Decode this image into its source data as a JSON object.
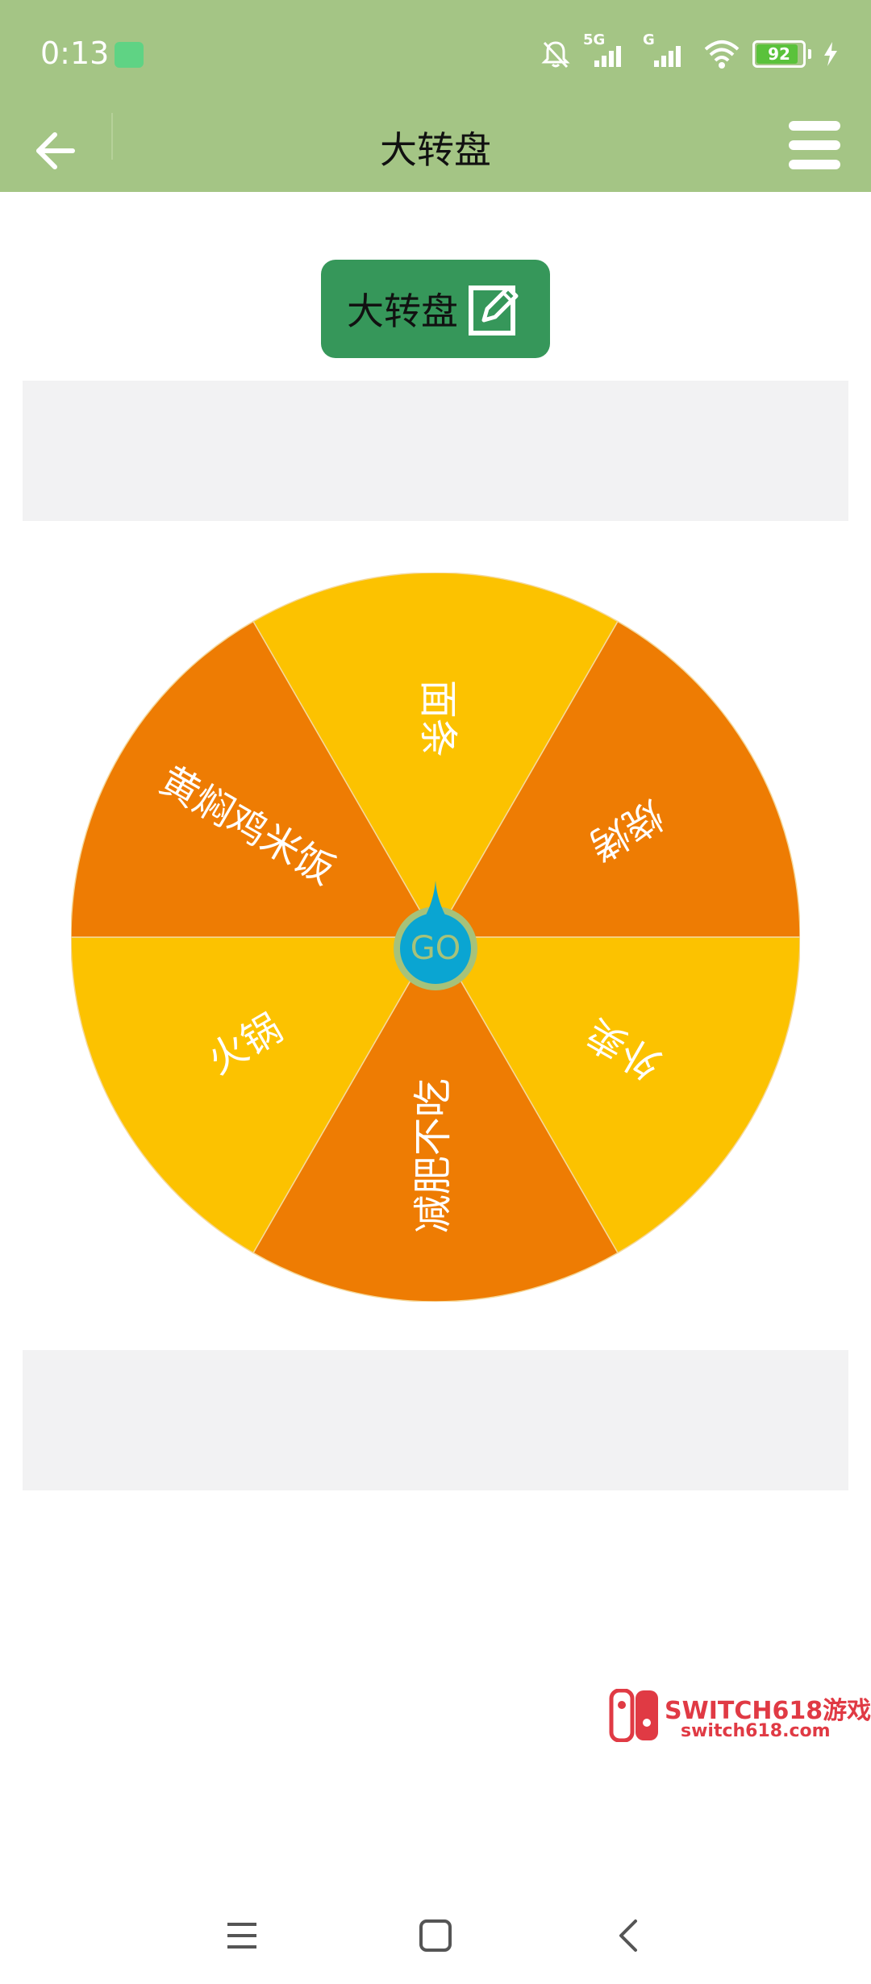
{
  "status_bar": {
    "time": "0:13",
    "network_1": "5G",
    "network_2": "G",
    "battery_level": "92",
    "battery_fraction": 0.92
  },
  "app_bar": {
    "title": "大转盘",
    "back_icon": "arrow-left-icon",
    "menu_icon": "hamburger-menu-icon"
  },
  "wheel_name_button": {
    "label": "大转盘",
    "icon": "edit-icon",
    "background": "#36975a"
  },
  "wheel": {
    "colors": {
      "yellow": "#fcc200",
      "orange": "#ee7c03",
      "center": "#0aa5d2",
      "center_ring": "#a6c27a"
    },
    "segments": [
      {
        "label": "面条",
        "color": "#fcc200"
      },
      {
        "label": "烧烤",
        "color": "#ee7c03"
      },
      {
        "label": "外卖",
        "color": "#fcc200"
      },
      {
        "label": "减肥不吃",
        "color": "#ee7c03"
      },
      {
        "label": "火锅",
        "color": "#fcc200"
      },
      {
        "label": "黄焖鸡米饭",
        "color": "#ee7c03"
      }
    ],
    "go_label": "GO"
  },
  "watermark": {
    "title": "SWITCH618游戏",
    "url": "switch618.com"
  },
  "nav_bar": {
    "recent_icon": "recent-apps-icon",
    "home_icon": "home-icon",
    "back_icon": "back-triangle-icon"
  }
}
